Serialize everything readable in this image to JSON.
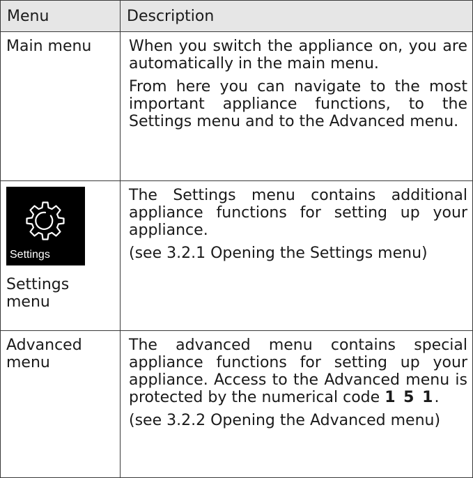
{
  "header": {
    "col1": "Menu",
    "col2": "Description"
  },
  "rows": [
    {
      "menu": "Main menu",
      "paragraphs": [
        "When you switch the appliance on, you are automatically in the main menu.",
        "From here you can navigate to the most important appliance functions, to the Settings menu and to the Advanced menu."
      ]
    },
    {
      "menu": "Settings menu",
      "tile_label": "Settings",
      "tile_icon": "gear-icon",
      "paragraphs": [
        "The Settings menu contains additional appliance functions for setting up your appliance.",
        "(see 3.2.1 Opening the Settings menu)"
      ]
    },
    {
      "menu": "Advanced menu",
      "adv_text_before": "The advanced menu contains special appliance functions for setting up your appliance. Access to the Advanced menu is protected by the numerical code ",
      "adv_code": "1 5 1",
      "adv_text_after": ".",
      "paragraphs": [
        "",
        "(see 3.2.2 Opening the Advanced menu)"
      ]
    }
  ]
}
